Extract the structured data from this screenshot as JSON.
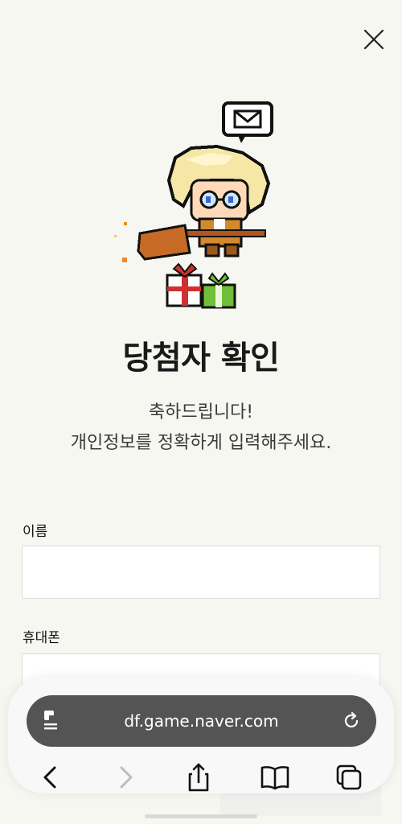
{
  "header": {
    "close_icon": "close-icon"
  },
  "hero": {
    "mascot_icon": "wizard-on-broom-with-gifts-illustration",
    "title": "당첨자 확인",
    "subtitle_line1": "축하드립니다!",
    "subtitle_line2": "개인정보를 정확하게 입력해주세요."
  },
  "form": {
    "name_label": "이름",
    "name_value": "",
    "phone_label": "휴대폰",
    "phone_value": ""
  },
  "browser": {
    "url": "df.game.naver.com",
    "toolbar": {
      "back_icon": "chevron-left-icon",
      "forward_icon": "chevron-right-icon",
      "share_icon": "share-icon",
      "bookmarks_icon": "book-icon",
      "tabs_icon": "tabs-icon"
    },
    "colors": {
      "pill_bg": "#545454",
      "disabled": "#bdbdbd"
    }
  }
}
